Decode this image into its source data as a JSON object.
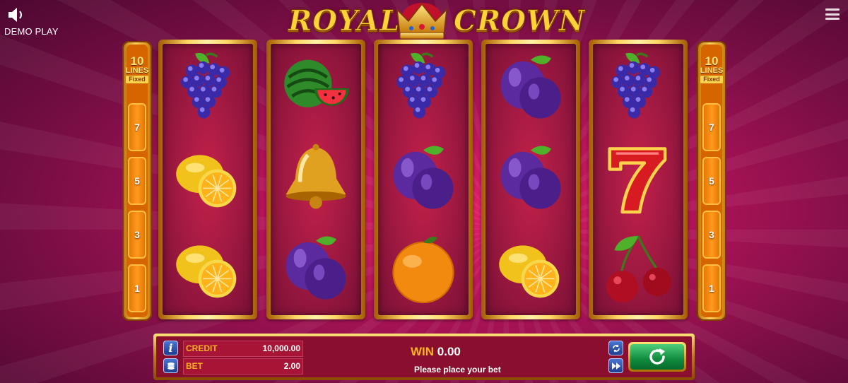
{
  "app": {
    "demo_label": "DEMO PLAY"
  },
  "logo": {
    "left": "ROYAL",
    "right": "CROWN"
  },
  "lines_badge": {
    "number": "10",
    "label": "LINES",
    "mode": "Fixed"
  },
  "line_markers": [
    "7",
    "5",
    "3",
    "1"
  ],
  "reels": [
    [
      "grapes",
      "lemon",
      "lemon"
    ],
    [
      "watermelon",
      "bell",
      "plum"
    ],
    [
      "grapes",
      "plum",
      "orange"
    ],
    [
      "plum",
      "plum",
      "lemon"
    ],
    [
      "grapes",
      "seven",
      "cherries"
    ]
  ],
  "panel": {
    "credit_label": "CREDIT",
    "credit_value": "10,000.00",
    "bet_label": "BET",
    "bet_value": "2.00",
    "win_label": "WIN",
    "win_value": "0.00",
    "message": "Please place your bet"
  },
  "icons": {
    "sound": "speaker-icon",
    "menu": "hamburger-menu-icon",
    "info": "info-icon",
    "bet": "coin-stack-icon",
    "autoplay": "autoplay-icon",
    "turbo": "fast-forward-icon",
    "spin": "spin-icon"
  },
  "colors": {
    "accent_gold": "#ffd23a",
    "spin_green": "#0f8a3e",
    "label_orange": "#ffb320",
    "background": "#b5145a"
  }
}
